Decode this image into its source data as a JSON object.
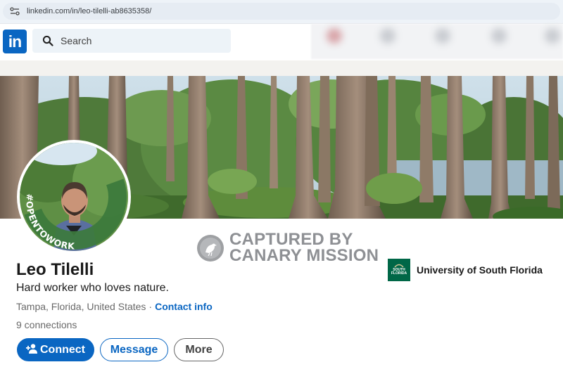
{
  "browser": {
    "url": "linkedin.com/in/leo-tilelli-ab8635358/"
  },
  "nav": {
    "logo_text": "in",
    "search_placeholder": "Search"
  },
  "watermark": {
    "line1": "CAPTURED BY",
    "line2": "CANARY MISSION"
  },
  "avatar": {
    "badge_text": "#OPENTOWORK"
  },
  "profile": {
    "name": "Leo Tilelli",
    "headline": "Hard worker who loves nature.",
    "location": "Tampa, Florida, United States",
    "separator": "·",
    "contact_info": "Contact info",
    "connections": "9 connections"
  },
  "actions": {
    "connect": "Connect",
    "message": "Message",
    "more": "More"
  },
  "education": {
    "logo_text": "SOUTH FLORIDA",
    "name": "University of South Florida"
  },
  "colors": {
    "brand_blue": "#0a66c2",
    "open_to_work_green": "#3c7a3c",
    "usf_green": "#006747"
  }
}
